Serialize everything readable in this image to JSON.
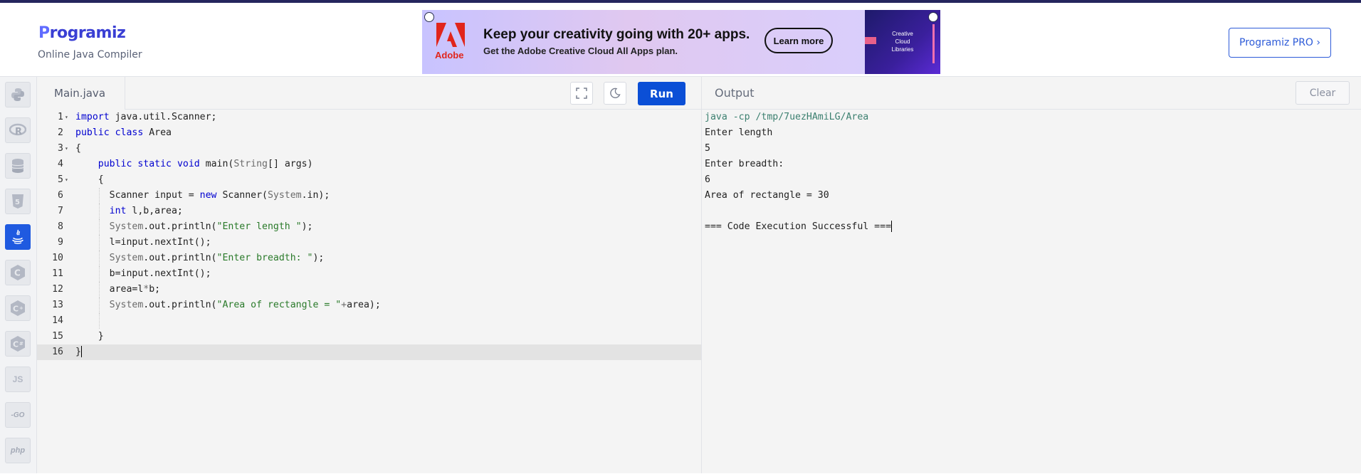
{
  "header": {
    "logo_text": "rogramiz",
    "logo_letter": "P",
    "subtitle": "Online Java Compiler",
    "pro_button": "Programiz PRO ›"
  },
  "ad": {
    "brand": "Adobe",
    "headline": "Keep your creativity going with 20+ apps.",
    "subline": "Get the Adobe Creative Cloud All Apps plan.",
    "cta": "Learn more",
    "image_caption": "Creative Cloud Libraries"
  },
  "sidebar": {
    "items": [
      {
        "name": "python",
        "label": "Py"
      },
      {
        "name": "r",
        "label": "R"
      },
      {
        "name": "sql",
        "label": "DB"
      },
      {
        "name": "html",
        "label": "5"
      },
      {
        "name": "java",
        "label": "☕",
        "active": true
      },
      {
        "name": "c",
        "label": "C"
      },
      {
        "name": "cpp",
        "label": "C"
      },
      {
        "name": "csharp",
        "label": "C"
      },
      {
        "name": "js",
        "label": "JS"
      },
      {
        "name": "go",
        "label": "-GO"
      },
      {
        "name": "php",
        "label": "php"
      }
    ]
  },
  "editor": {
    "tab": "Main.java",
    "run_label": "Run",
    "lines": [
      "import java.util.Scanner;",
      "public class Area",
      "{",
      "    public static void main(String[] args)",
      "    {",
      "      Scanner input = new Scanner(System.in);",
      "      int l,b,area;",
      "      System.out.println(\"Enter length \");",
      "      l=input.nextInt();",
      "      System.out.println(\"Enter breadth: \");",
      "      b=input.nextInt();",
      "      area=l*b;",
      "      System.out.println(\"Area of rectangle = \"+area);",
      "",
      "    }",
      "}"
    ]
  },
  "output": {
    "title": "Output",
    "clear_label": "Clear",
    "lines": [
      "java -cp /tmp/7uezHAmiLG/Area",
      "Enter length",
      "5",
      "Enter breadth:",
      "6",
      "Area of rectangle = 30",
      "",
      "=== Code Execution Successful ==="
    ]
  }
}
